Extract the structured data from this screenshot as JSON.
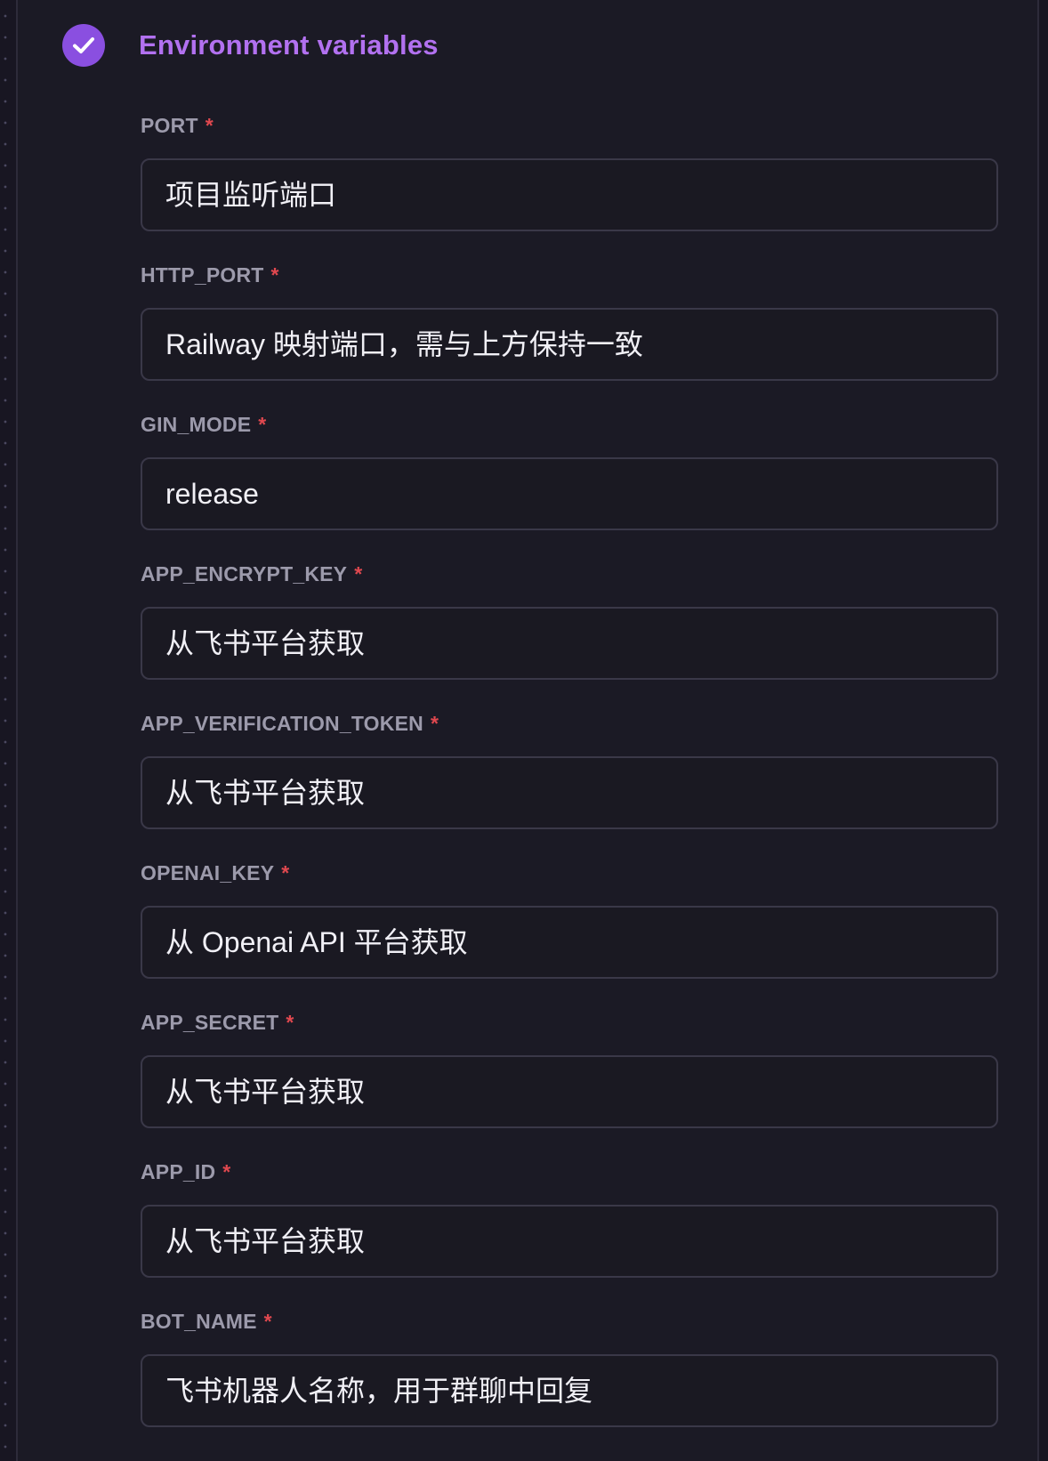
{
  "section": {
    "title": "Environment variables",
    "status_icon": "check-circle-icon",
    "accent_color": "#8a4fe0"
  },
  "fields": [
    {
      "label": "PORT",
      "required": "*",
      "placeholder": "项目监听端口"
    },
    {
      "label": "HTTP_PORT",
      "required": "*",
      "placeholder": "Railway 映射端口，需与上方保持一致"
    },
    {
      "label": "GIN_MODE",
      "required": "*",
      "placeholder": "release"
    },
    {
      "label": "APP_ENCRYPT_KEY",
      "required": "*",
      "placeholder": "从飞书平台获取"
    },
    {
      "label": "APP_VERIFICATION_TOKEN",
      "required": "*",
      "placeholder": "从飞书平台获取"
    },
    {
      "label": "OPENAI_KEY",
      "required": "*",
      "placeholder": "从 Openai API 平台获取"
    },
    {
      "label": "APP_SECRET",
      "required": "*",
      "placeholder": "从飞书平台获取"
    },
    {
      "label": "APP_ID",
      "required": "*",
      "placeholder": "从飞书平台获取"
    },
    {
      "label": "BOT_NAME",
      "required": "*",
      "placeholder": "飞书机器人名称，用于群聊中回复"
    }
  ]
}
